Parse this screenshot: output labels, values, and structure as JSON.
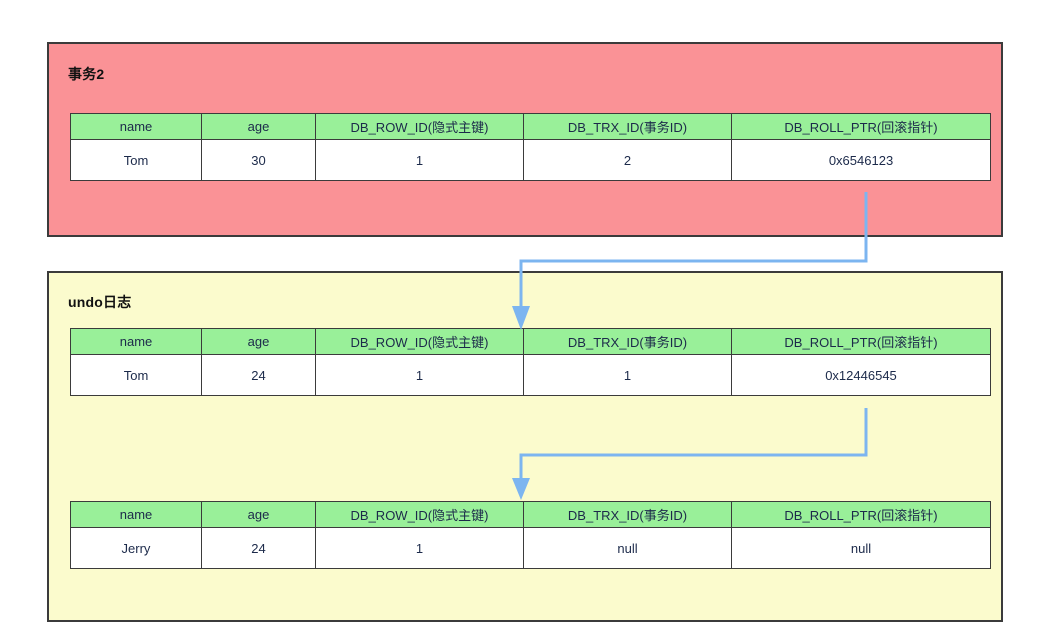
{
  "diagram": {
    "title_transaction": "事务2",
    "title_undo_log": "undo日志",
    "columns": [
      "name",
      "age",
      "DB_ROW_ID(隐式主键)",
      "DB_TRX_ID(事务ID)",
      "DB_ROLL_PTR(回滚指针)"
    ],
    "rows": {
      "current": {
        "name": "Tom",
        "age": "30",
        "db_row_id": "1",
        "db_trx_id": "2",
        "db_roll_ptr": "0x6546123"
      },
      "undo_first": {
        "name": "Tom",
        "age": "24",
        "db_row_id": "1",
        "db_trx_id": "1",
        "db_roll_ptr": "0x12446545"
      },
      "undo_second": {
        "name": "Jerry",
        "age": "24",
        "db_row_id": "1",
        "db_trx_id": "null",
        "db_roll_ptr": "null"
      }
    },
    "colors": {
      "transaction_box": "#fa9296",
      "undo_box": "#fbfbcd",
      "header_cell": "#99f099",
      "arrow": "#7cb5f0",
      "border": "#3b3b3b"
    }
  }
}
